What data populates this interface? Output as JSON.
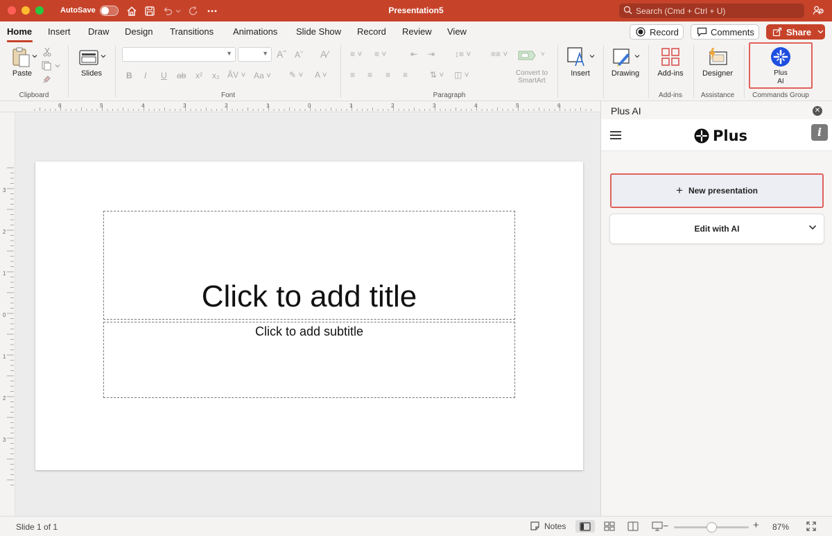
{
  "titlebar": {
    "autosave_label": "AutoSave",
    "document_title": "Presentation5",
    "search_placeholder": "Search (Cmd + Ctrl + U)"
  },
  "menu": {
    "tabs": [
      "Home",
      "Insert",
      "Draw",
      "Design",
      "Transitions",
      "Animations",
      "Slide Show",
      "Record",
      "Review",
      "View"
    ],
    "active_tab": "Home",
    "record_label": "Record",
    "comments_label": "Comments",
    "share_label": "Share"
  },
  "ribbon": {
    "paste_label": "Paste",
    "clipboard_group": "Clipboard",
    "slides_label": "Slides",
    "font_group": "Font",
    "paragraph_group": "Paragraph",
    "convert_smartart_line1": "Convert to",
    "convert_smartart_line2": "SmartArt",
    "insert_label": "Insert",
    "drawing_label": "Drawing",
    "addins_label": "Add-ins",
    "addins_group": "Add-ins",
    "designer_label": "Designer",
    "assistance_group": "Assistance",
    "plusai_line1": "Plus",
    "plusai_line2": "AI",
    "commands_group": "Commands Group"
  },
  "slide": {
    "title_placeholder": "Click to add title",
    "subtitle_placeholder": "Click to add subtitle"
  },
  "ruler": {
    "top_labels": [
      "6",
      "5",
      "4",
      "3",
      "2",
      "1",
      "0",
      "1",
      "2",
      "3",
      "4",
      "5",
      "6"
    ],
    "left_labels": [
      "3",
      "2",
      "1",
      "0",
      "1",
      "2",
      "3"
    ]
  },
  "panel": {
    "title": "Plus AI",
    "logo_text": "Plus",
    "info_label": "i",
    "new_presentation_label": "New presentation",
    "edit_with_ai_label": "Edit with AI"
  },
  "statusbar": {
    "slide_count": "Slide 1 of 1",
    "notes_label": "Notes",
    "zoom_level": "87%",
    "zoom_fraction": 0.5
  },
  "colors": {
    "brand": "#c6432a",
    "highlight": "#e0605b",
    "plus_blue": "#1f4fe0"
  }
}
